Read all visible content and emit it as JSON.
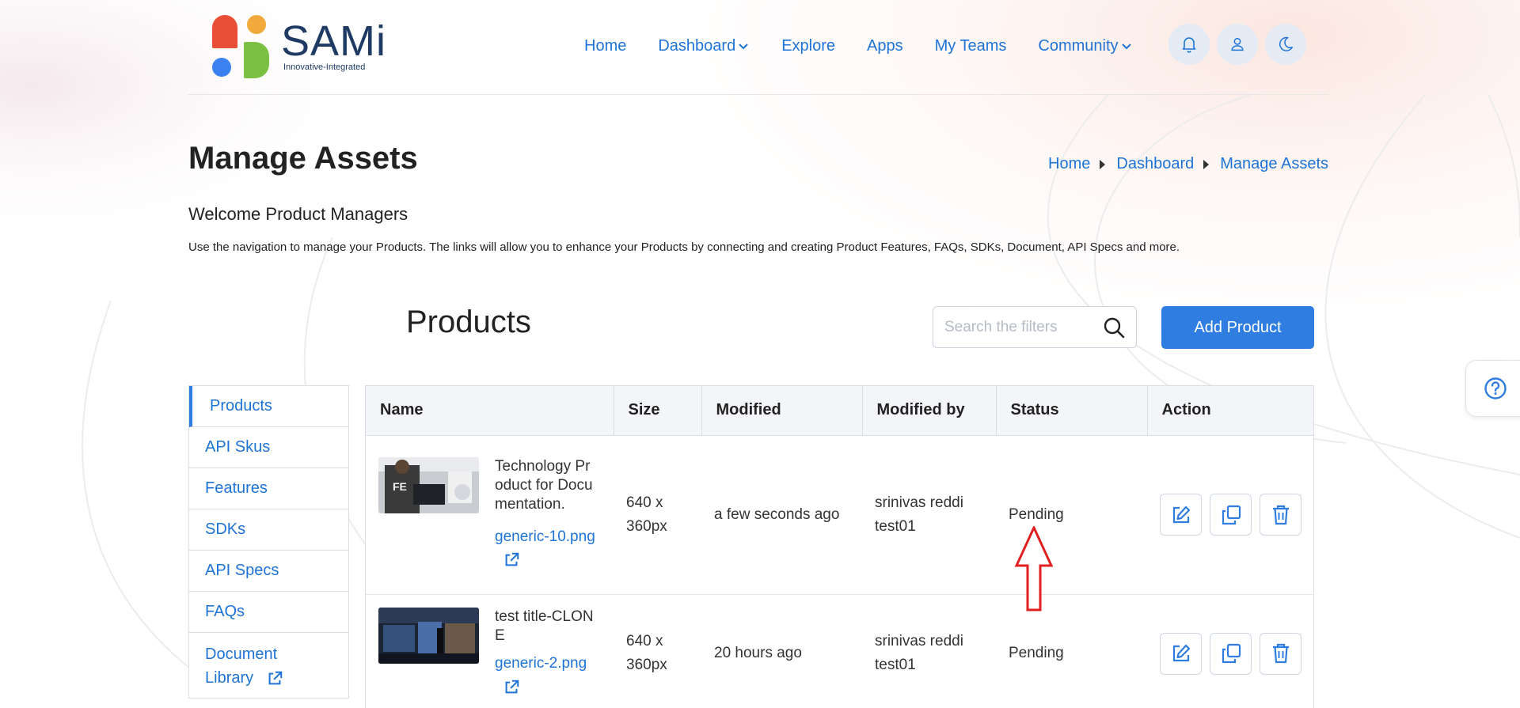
{
  "brand": {
    "name": "SAMi",
    "tagline": "Innovative-Integrated"
  },
  "nav": {
    "items": [
      {
        "label": "Home",
        "dropdown": false
      },
      {
        "label": "Dashboard",
        "dropdown": true
      },
      {
        "label": "Explore",
        "dropdown": false
      },
      {
        "label": "Apps",
        "dropdown": false
      },
      {
        "label": "My Teams",
        "dropdown": false
      },
      {
        "label": "Community",
        "dropdown": true
      }
    ],
    "icons": [
      "bell-icon",
      "user-icon",
      "moon-icon"
    ]
  },
  "page": {
    "title": "Manage Assets",
    "breadcrumb": [
      "Home",
      "Dashboard",
      "Manage Assets"
    ],
    "welcome": "Welcome Product Managers",
    "intro": "Use the navigation to manage your Products. The links will allow you to enhance your Products by connecting and creating Product Features, FAQs, SDKs, Document, API Specs and more."
  },
  "products": {
    "title": "Products",
    "search_placeholder": "Search the filters",
    "add_label": "Add Product"
  },
  "sidebar": {
    "items": [
      "Products",
      "API Skus",
      "Features",
      "SDKs",
      "API Specs",
      "FAQs",
      "Document Library"
    ],
    "active": "Products"
  },
  "table": {
    "columns": [
      "Name",
      "Size",
      "Modified",
      "Modified by",
      "Status",
      "Action"
    ],
    "rows": [
      {
        "name": "Technology Product for Documentation.",
        "file": "generic-10.png",
        "size": "640 x 360px",
        "modified": "a few seconds ago",
        "modified_by": "srinivas reddi test01",
        "status": "Pending"
      },
      {
        "name": "test title-CLONE",
        "file": "generic-2.png",
        "size": "640 x 360px",
        "modified": "20 hours ago",
        "modified_by": "srinivas reddi test01",
        "status": "Pending"
      }
    ]
  },
  "colors": {
    "accent": "#2f7de1",
    "link": "#1e73d6",
    "brand_text": "#1f3b64",
    "annotation_arrow": "#e02020"
  }
}
